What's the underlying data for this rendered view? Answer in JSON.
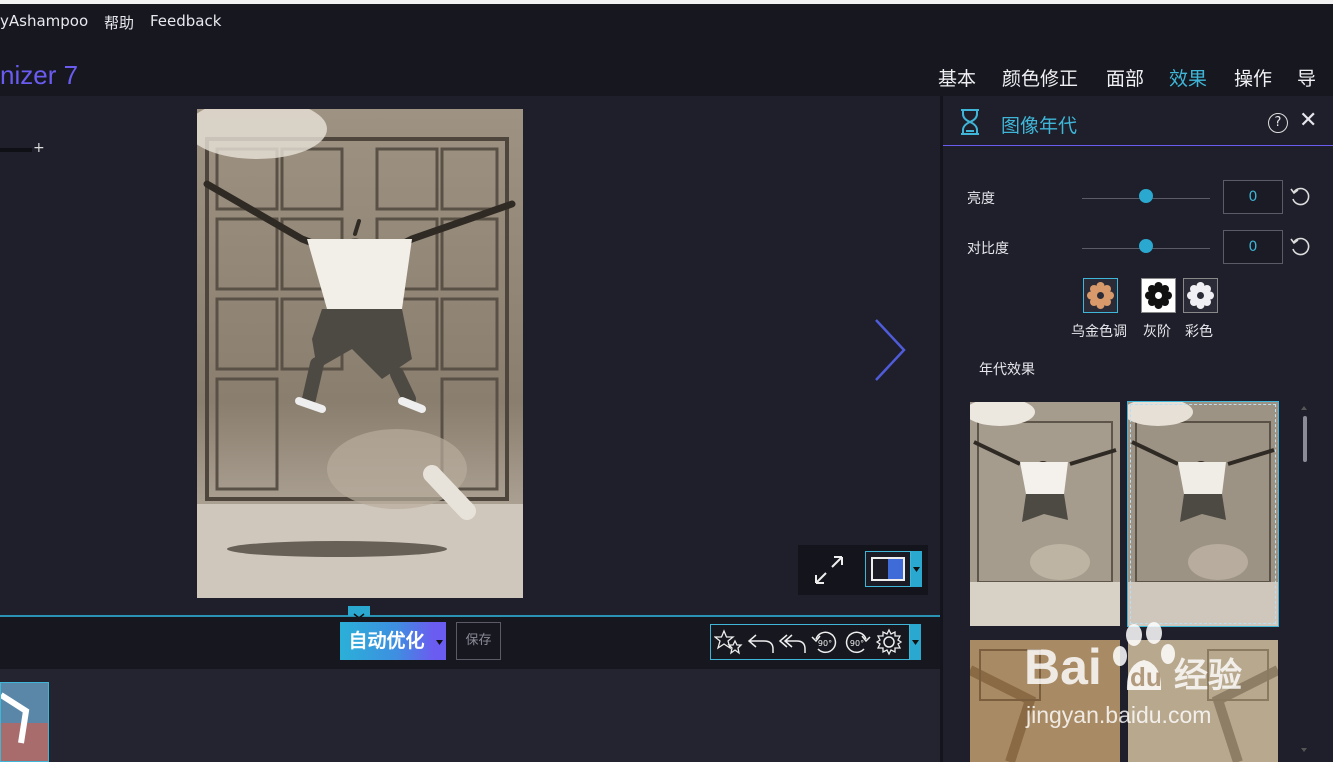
{
  "menu": {
    "items": [
      "yAshampoo",
      "帮助",
      "Feedback"
    ]
  },
  "app": {
    "title": "nizer 7"
  },
  "tabs": [
    "基本",
    "颜色修正",
    "面部",
    "效果",
    "操作",
    "导出"
  ],
  "active_tab": "效果",
  "toolbar": {
    "auto_optimize": "自动优化",
    "save": "保存",
    "tool_icons": [
      "stars-icon",
      "undo-icon",
      "undo-all-icon",
      "rotate-left-90-icon",
      "rotate-right-90-icon",
      "settings-icon"
    ]
  },
  "panel": {
    "title": "图像年代",
    "help": "?",
    "close": "✕",
    "brightness": {
      "label": "亮度",
      "value": "0",
      "position": 0.5
    },
    "contrast": {
      "label": "对比度",
      "value": "0",
      "position": 0.5
    },
    "modes": [
      {
        "label": "乌金色调",
        "icon": "sepia-flower-icon"
      },
      {
        "label": "灰阶",
        "icon": "grayscale-flower-icon"
      },
      {
        "label": "彩色",
        "icon": "color-flower-icon"
      }
    ],
    "effects_title": "年代效果"
  },
  "watermark": {
    "brand": "Bai",
    "brand_cn": "经验",
    "url": "jingyan.baidu.com"
  },
  "colors": {
    "accent": "#3fb6d8",
    "purple": "#6a5cf0",
    "background": "#1e1f2a",
    "bar": "#16171f"
  }
}
